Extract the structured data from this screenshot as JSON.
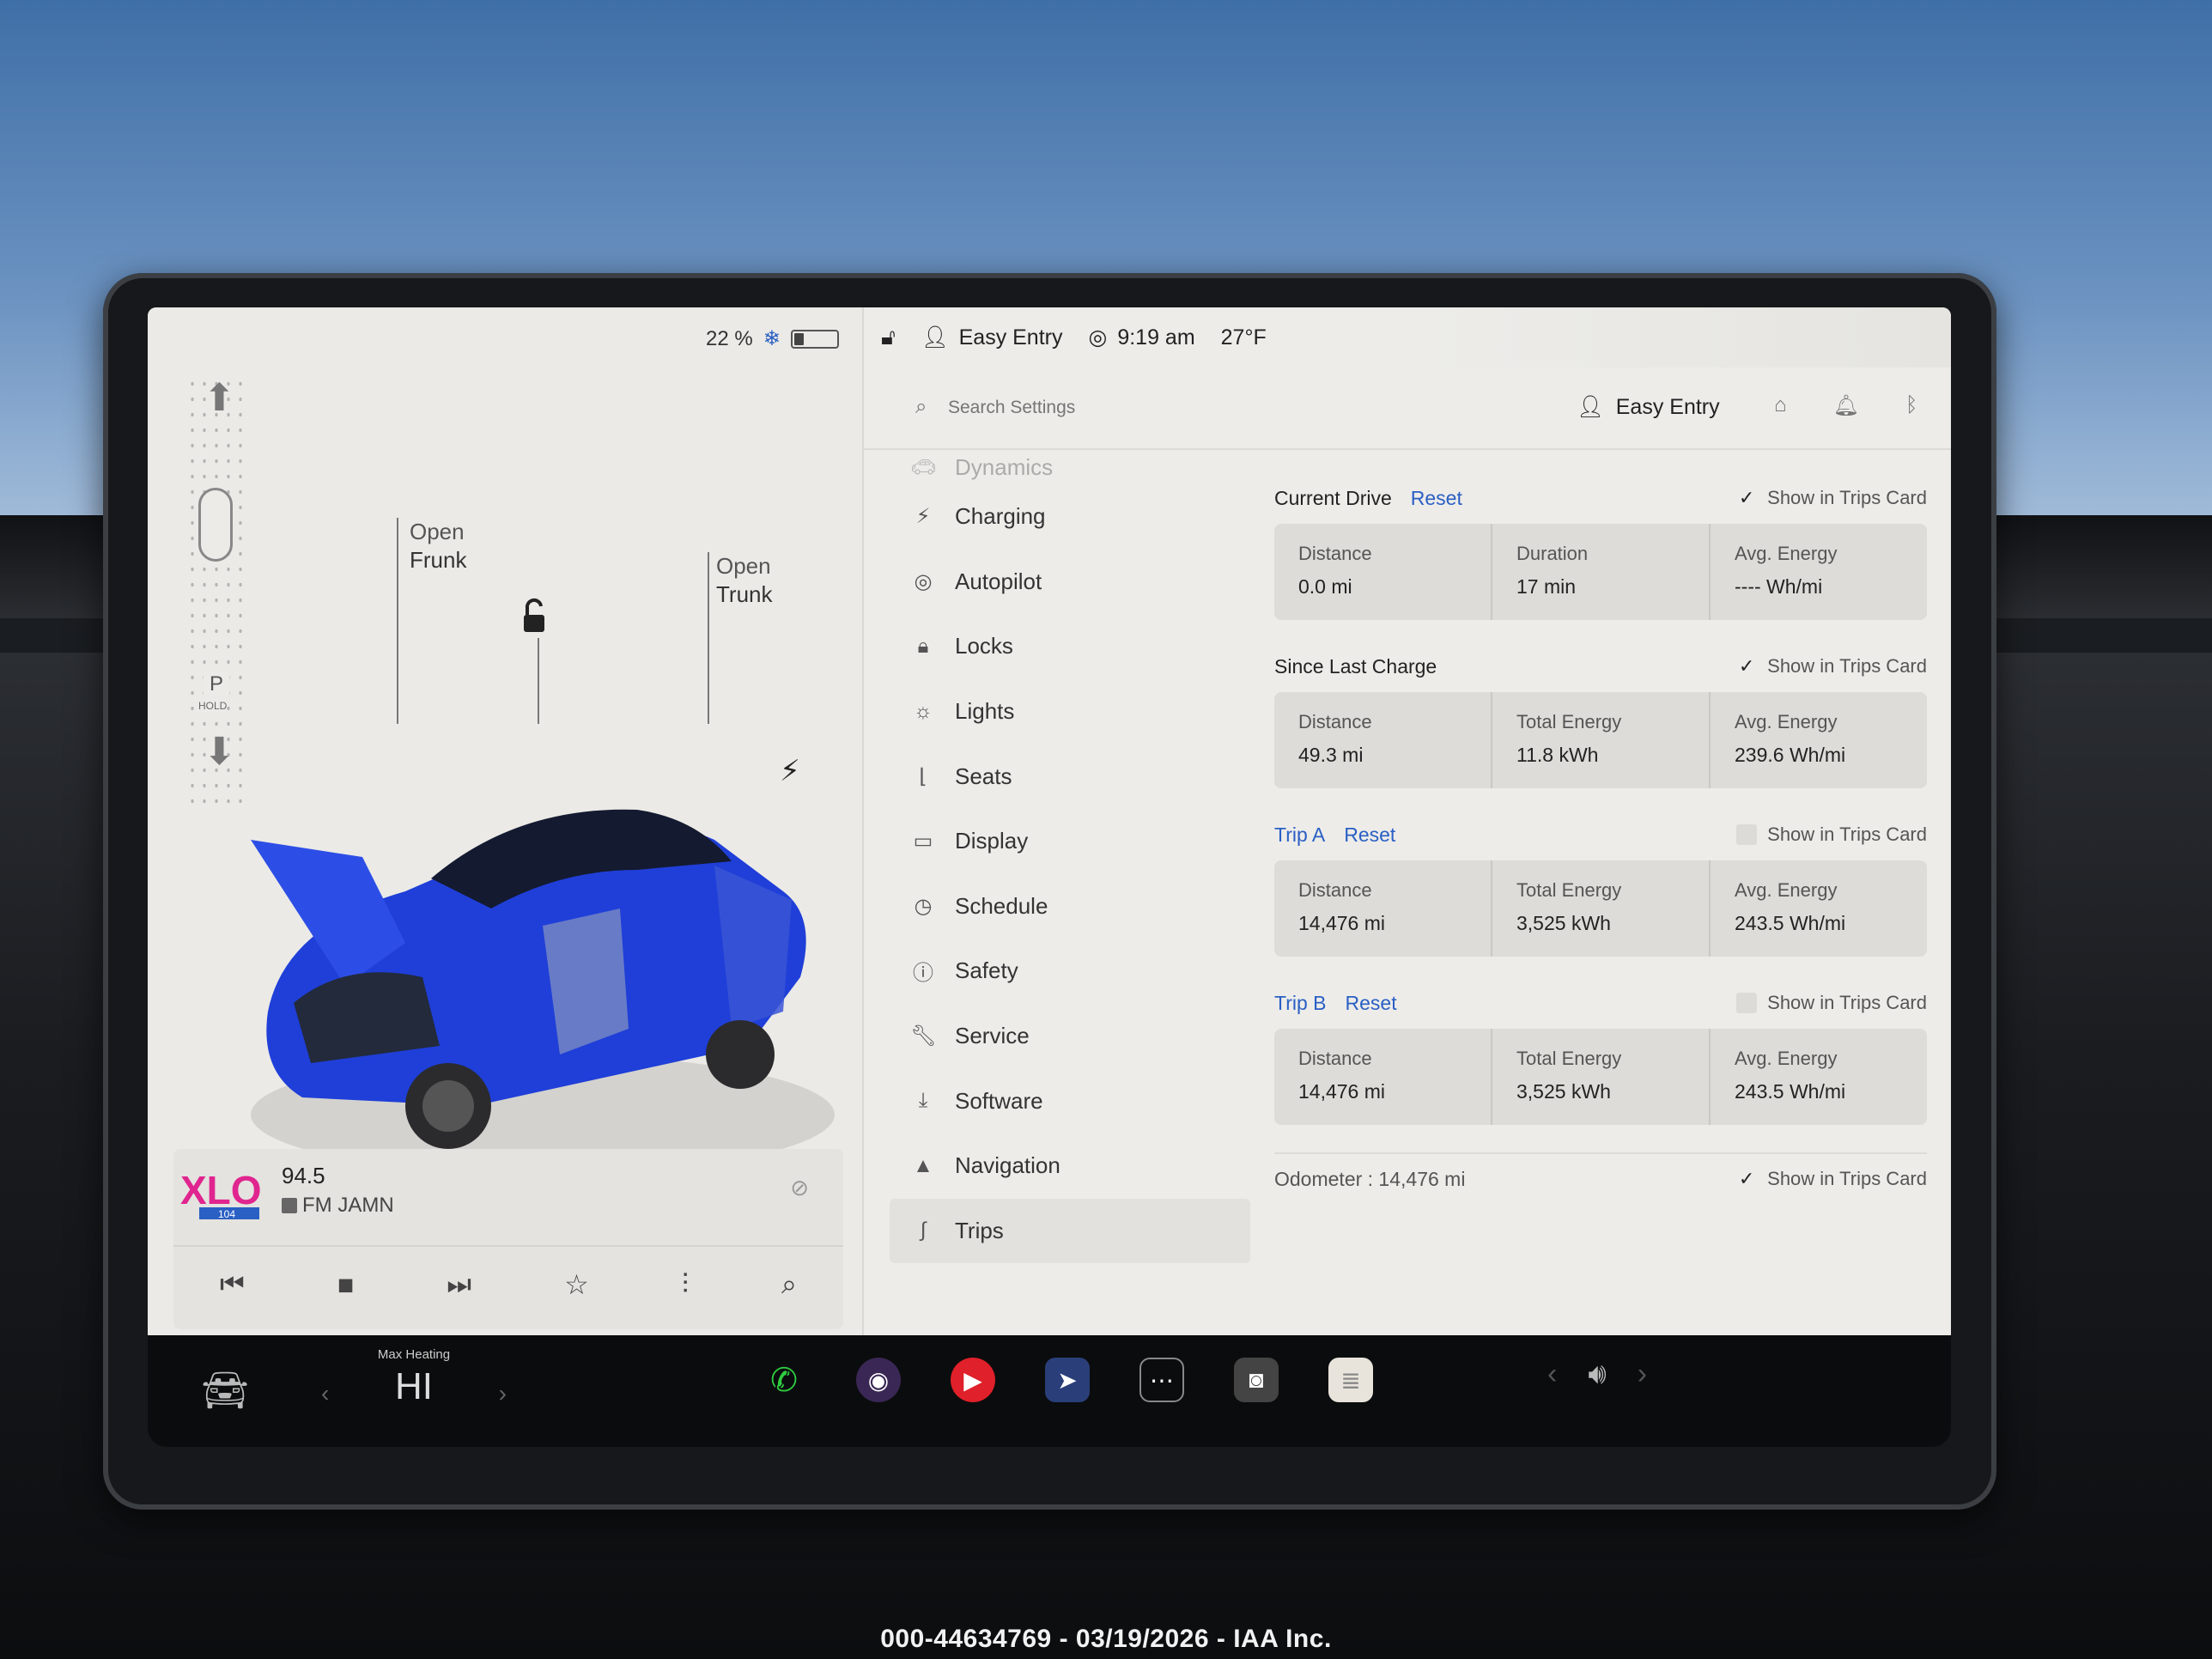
{
  "status": {
    "battery_percent": "22 %",
    "battery_level": 0.22,
    "lock_state": "unlocked",
    "profile": "Easy Entry",
    "time": "9:19 am",
    "temperature": "27°F"
  },
  "car_panel": {
    "gear": "P",
    "gear_hold": "HOLD",
    "frunk_line1": "Open",
    "frunk_line2": "Frunk",
    "trunk_line1": "Open",
    "trunk_line2": "Trunk",
    "car_color": "#1f3fd8"
  },
  "media": {
    "logo_text": "XLO",
    "logo_sub": "104",
    "frequency": "94.5",
    "station": "FM JAMN",
    "controls": [
      "prev-icon",
      "stop-icon",
      "next-icon",
      "star-icon",
      "equalizer-icon",
      "search-icon"
    ]
  },
  "settings_header": {
    "search_placeholder": "Search Settings",
    "profile": "Easy Entry"
  },
  "menu": {
    "items": [
      {
        "label": "Dynamics",
        "icon": "car-icon"
      },
      {
        "label": "Charging",
        "icon": "bolt-icon"
      },
      {
        "label": "Autopilot",
        "icon": "steering-wheel-icon"
      },
      {
        "label": "Locks",
        "icon": "lock-icon"
      },
      {
        "label": "Lights",
        "icon": "sun-icon"
      },
      {
        "label": "Seats",
        "icon": "seat-icon"
      },
      {
        "label": "Display",
        "icon": "display-icon"
      },
      {
        "label": "Schedule",
        "icon": "clock-icon"
      },
      {
        "label": "Safety",
        "icon": "alert-icon"
      },
      {
        "label": "Service",
        "icon": "wrench-icon"
      },
      {
        "label": "Software",
        "icon": "download-icon"
      },
      {
        "label": "Navigation",
        "icon": "arrow-icon"
      },
      {
        "label": "Trips",
        "icon": "trips-icon"
      }
    ],
    "active": "Trips"
  },
  "trips": {
    "show_label": "Show in Trips Card",
    "reset_label": "Reset",
    "current_drive": {
      "title": "Current Drive",
      "show_checked": true,
      "cells": [
        {
          "label": "Distance",
          "value": "0.0  mi"
        },
        {
          "label": "Duration",
          "value": "17  min"
        },
        {
          "label": "Avg. Energy",
          "value": "----  Wh/mi"
        }
      ]
    },
    "since_last_charge": {
      "title": "Since Last Charge",
      "show_checked": true,
      "cells": [
        {
          "label": "Distance",
          "value": "49.3  mi"
        },
        {
          "label": "Total Energy",
          "value": "11.8  kWh"
        },
        {
          "label": "Avg. Energy",
          "value": "239.6  Wh/mi"
        }
      ]
    },
    "trip_a": {
      "title": "Trip A",
      "show_checked": false,
      "cells": [
        {
          "label": "Distance",
          "value": "14,476  mi"
        },
        {
          "label": "Total Energy",
          "value": "3,525  kWh"
        },
        {
          "label": "Avg. Energy",
          "value": "243.5  Wh/mi"
        }
      ]
    },
    "trip_b": {
      "title": "Trip B",
      "show_checked": false,
      "cells": [
        {
          "label": "Distance",
          "value": "14,476  mi"
        },
        {
          "label": "Total Energy",
          "value": "3,525  kWh"
        },
        {
          "label": "Avg. Energy",
          "value": "243.5  Wh/mi"
        }
      ]
    },
    "odometer": {
      "label": "Odometer  :  14,476  mi",
      "show_checked": true
    }
  },
  "dock": {
    "climate_title": "Max Heating",
    "climate_value": "HI",
    "apps": [
      "phone-icon",
      "camera-lens-icon",
      "media-player-icon",
      "navigation-app-icon",
      "more-apps-icon",
      "dashcam-icon",
      "notes-icon"
    ]
  },
  "watermark": "000-44634769 - 03/19/2026 - IAA Inc.",
  "colors": {
    "accent_blue": "#2a5fc4",
    "screen_bg": "#ecebe8",
    "card_bg": "#dddcd8"
  }
}
